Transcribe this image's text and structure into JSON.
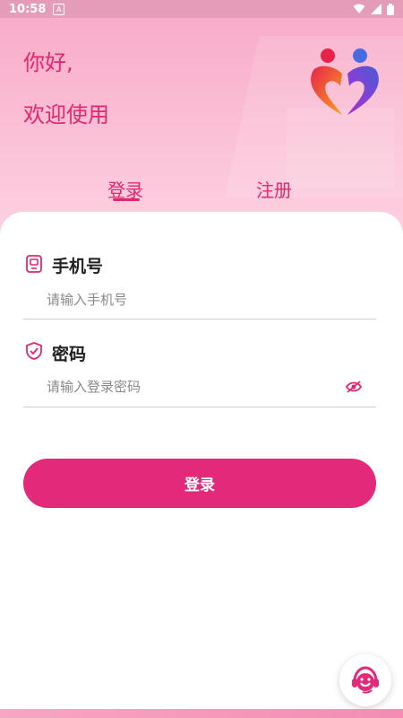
{
  "status_bar": {
    "time": "10:58",
    "notification_icon": "A"
  },
  "greeting": {
    "line1": "你好,",
    "line2": "欢迎使用"
  },
  "tabs": [
    {
      "label": "登录",
      "active": true
    },
    {
      "label": "注册",
      "active": false
    }
  ],
  "form": {
    "phone": {
      "label": "手机号",
      "placeholder": "请输入手机号",
      "value": ""
    },
    "password": {
      "label": "密码",
      "placeholder": "请输入登录密码",
      "value": ""
    },
    "submit_label": "登录"
  },
  "colors": {
    "accent": "#e2276e",
    "button": "#e3297a"
  },
  "icons": [
    "phone-icon",
    "shield-icon",
    "eye-icon",
    "customer-service-icon",
    "app-logo"
  ]
}
